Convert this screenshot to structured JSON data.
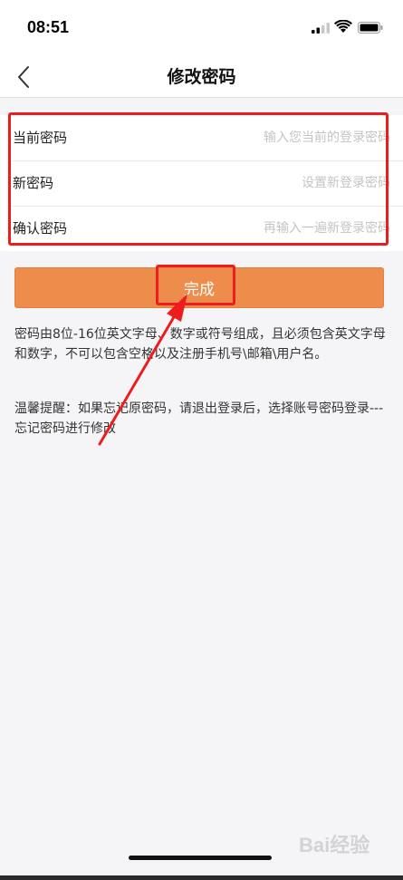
{
  "status_bar": {
    "time": "08:51"
  },
  "nav": {
    "title": "修改密码",
    "back_icon": "chevron-left-icon"
  },
  "form": {
    "current_password": {
      "label": "当前密码",
      "placeholder": "输入您当前的登录密码"
    },
    "new_password": {
      "label": "新密码",
      "placeholder": "设置新登录密码"
    },
    "confirm_password": {
      "label": "确认密码",
      "placeholder": "再输入一遍新登录密码"
    }
  },
  "submit": {
    "label": "完成",
    "color": "#ee8c4b"
  },
  "rule_text": "密码由8位-16位英文字母、数字或符号组成，且必须包含英文字母和数字，不可以包含空格以及注册手机号\\邮箱\\用户名。",
  "tip_text": "温馨提醒：如果忘记原密码，请退出登录后，选择账号密码登录---忘记密码进行修改",
  "watermark": "Bai经验",
  "annotation_color": "#ee1c1c"
}
